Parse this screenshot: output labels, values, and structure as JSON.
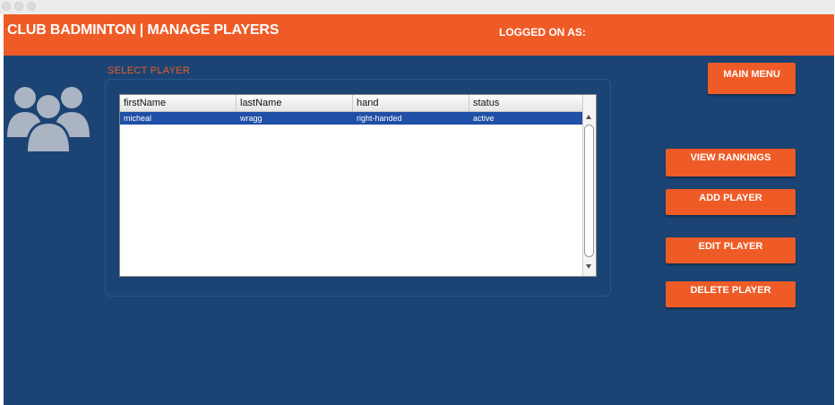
{
  "header": {
    "title": "CLUB BADMINTON | MANAGE PLAYERS",
    "logged_on_label": "LOGGED ON AS:"
  },
  "section_label": "SELECT PLAYER",
  "table": {
    "columns": [
      "firstName",
      "lastName",
      "hand",
      "status"
    ],
    "rows": [
      [
        "micheal",
        "wragg",
        "right-handed",
        "active"
      ]
    ]
  },
  "buttons": {
    "main_menu": "MAIN MENU",
    "view_rankings": "VIEW RANKINGS",
    "add_player": "ADD PLAYER",
    "edit_player": "EDIT PLAYER",
    "delete_player": "DELETE PLAYER"
  },
  "icons": {
    "avatar": "users-group-icon"
  },
  "colors": {
    "accent": "#ef5b26",
    "background": "#1b4474",
    "selection": "#1f4fa6"
  }
}
